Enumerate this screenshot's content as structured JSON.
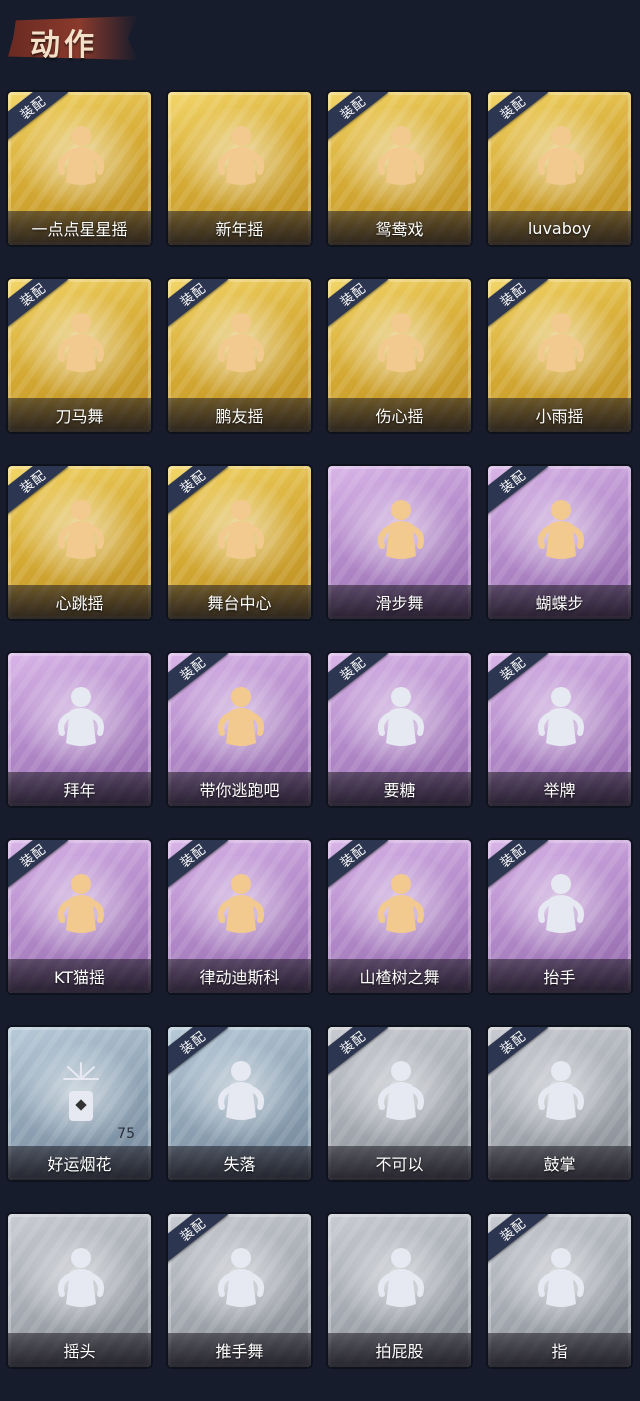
{
  "header": {
    "title": "动作"
  },
  "badge_label": "装配",
  "cards": [
    {
      "label": "一点点星星摇",
      "tier": "gold",
      "equipped": true,
      "figure": "gold"
    },
    {
      "label": "新年摇",
      "tier": "gold",
      "equipped": false,
      "figure": "gold"
    },
    {
      "label": "鸳鸯戏",
      "tier": "gold",
      "equipped": true,
      "figure": "gold"
    },
    {
      "label": "luvaboy",
      "tier": "gold",
      "equipped": true,
      "figure": "gold"
    },
    {
      "label": "刀马舞",
      "tier": "gold",
      "equipped": true,
      "figure": "gold"
    },
    {
      "label": "鹏友摇",
      "tier": "gold",
      "equipped": true,
      "figure": "gold"
    },
    {
      "label": "伤心摇",
      "tier": "gold",
      "equipped": true,
      "figure": "gold"
    },
    {
      "label": "小雨摇",
      "tier": "gold",
      "equipped": true,
      "figure": "gold"
    },
    {
      "label": "心跳摇",
      "tier": "gold",
      "equipped": true,
      "figure": "gold"
    },
    {
      "label": "舞台中心",
      "tier": "gold",
      "equipped": true,
      "figure": "gold"
    },
    {
      "label": "滑步舞",
      "tier": "purple",
      "equipped": false,
      "figure": "gold"
    },
    {
      "label": "蝴蝶步",
      "tier": "purple",
      "equipped": true,
      "figure": "gold"
    },
    {
      "label": "拜年",
      "tier": "purple",
      "equipped": false,
      "figure": "silver"
    },
    {
      "label": "带你逃跑吧",
      "tier": "purple",
      "equipped": true,
      "figure": "gold"
    },
    {
      "label": "要糖",
      "tier": "purple",
      "equipped": true,
      "figure": "silver"
    },
    {
      "label": "举牌",
      "tier": "purple",
      "equipped": true,
      "figure": "silver"
    },
    {
      "label": "KT猫摇",
      "tier": "purple",
      "equipped": true,
      "figure": "gold"
    },
    {
      "label": "律动迪斯科",
      "tier": "purple",
      "equipped": true,
      "figure": "gold"
    },
    {
      "label": "山楂树之舞",
      "tier": "purple",
      "equipped": true,
      "figure": "gold"
    },
    {
      "label": "抬手",
      "tier": "purple",
      "equipped": true,
      "figure": "silver"
    },
    {
      "label": "好运烟花",
      "tier": "blue",
      "equipped": false,
      "figure": "item",
      "count": "75"
    },
    {
      "label": "失落",
      "tier": "blue",
      "equipped": true,
      "figure": "silver"
    },
    {
      "label": "不可以",
      "tier": "grey",
      "equipped": true,
      "figure": "silver"
    },
    {
      "label": "鼓掌",
      "tier": "grey",
      "equipped": true,
      "figure": "silver"
    },
    {
      "label": "摇头",
      "tier": "grey",
      "equipped": false,
      "figure": "silver"
    },
    {
      "label": "推手舞",
      "tier": "grey",
      "equipped": true,
      "figure": "silver"
    },
    {
      "label": "拍屁股",
      "tier": "grey",
      "equipped": false,
      "figure": "silver"
    },
    {
      "label": "指",
      "tier": "grey",
      "equipped": true,
      "figure": "silver"
    }
  ],
  "colors": {
    "background": "#161c2b",
    "gold_figure": "#f2c98e",
    "silver_figure": "#e6e9f1",
    "badge": "#2d3650"
  }
}
